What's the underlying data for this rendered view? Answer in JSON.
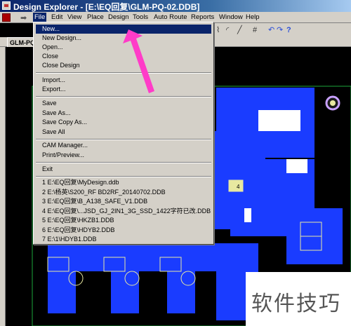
{
  "window": {
    "title": "Design Explorer - [E:\\EQ回复\\GLM-PQ-02.DDB]"
  },
  "menubar": {
    "items": [
      "File",
      "Edit",
      "View",
      "Place",
      "Design",
      "Tools",
      "Auto Route",
      "Reports",
      "Window",
      "Help"
    ]
  },
  "tab": {
    "label": "GLM-PQ"
  },
  "file_menu": {
    "items": [
      "New...",
      "New Design...",
      "Open...",
      "Close",
      "Close Design",
      "Import...",
      "Export...",
      "Save",
      "Save As...",
      "Save Copy As...",
      "Save All",
      "CAM Manager...",
      "Print/Preview...",
      "Exit"
    ],
    "recent": [
      "1 E:\\EQ回复\\MyDesign.ddb",
      "2 E:\\杨英\\S200_RF  BD2RF_20140702.DDB",
      "3 E:\\EQ回复\\B_A138_SAFE_V1.DDB",
      "4 E:\\EQ回复\\...JSD_GJ_2IN1_3G_SSD_1422字符已改.DDB",
      "5 E:\\EQ回复\\HKZB1.DDB",
      "6 E:\\EQ回复\\HDYB2.DDB",
      "7 E:\\1\\HDYB1.DDB"
    ]
  },
  "canvas": {
    "component_label": "4"
  },
  "watermark": {
    "text": "软件技巧"
  },
  "colors": {
    "accent": "#0a246a",
    "copper": "#1a3cff",
    "pad": "#e8e8a0",
    "arrow": "#ff3cc8"
  }
}
